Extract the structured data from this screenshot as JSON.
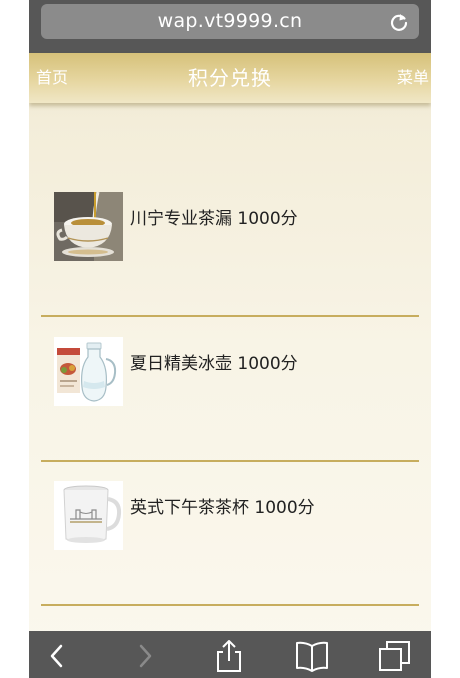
{
  "browser": {
    "url": "wap.vt9999.cn",
    "reload_icon": "reload-icon"
  },
  "header": {
    "home_label": "首页",
    "title": "积分兑换",
    "menu_label": "菜单"
  },
  "products": [
    {
      "text": "川宁专业茶漏 1000分",
      "image": "tea-strainer-image"
    },
    {
      "text": "夏日精美冰壶 1000分",
      "image": "water-jug-image"
    },
    {
      "text": "英式下午茶茶杯 1000分",
      "image": "tea-mug-image"
    }
  ],
  "toolbar": {
    "icons": [
      "back-icon",
      "forward-icon",
      "share-icon",
      "bookmarks-icon",
      "tabs-icon"
    ]
  },
  "colors": {
    "accent_gold": "#c7ad5e",
    "browser_chrome": "#575757",
    "header_gold": "#d6c17a"
  }
}
